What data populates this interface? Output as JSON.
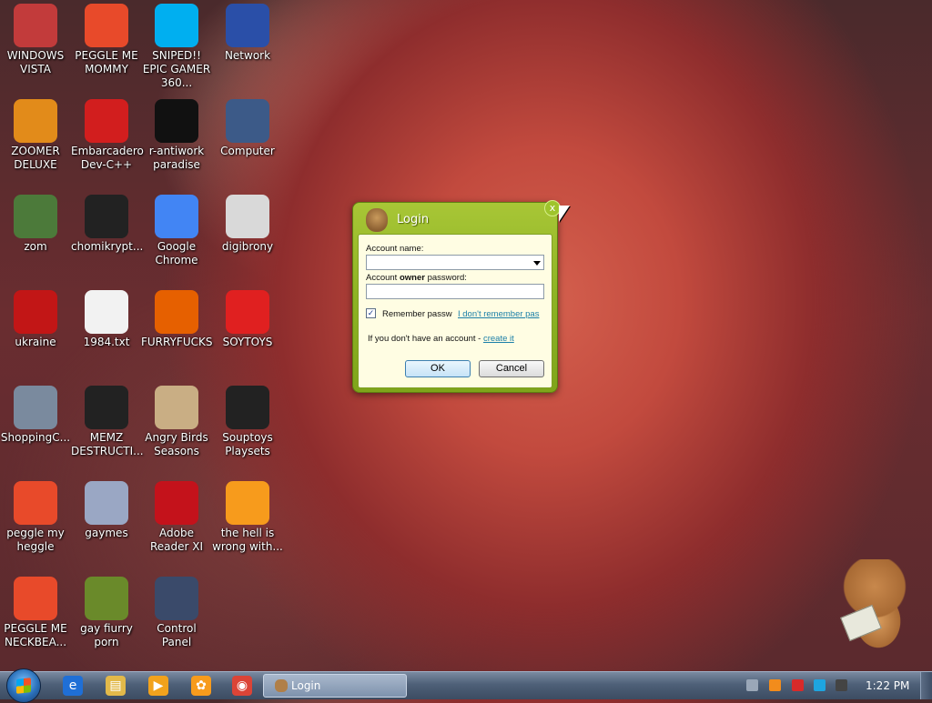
{
  "desktop": {
    "icons": [
      {
        "label": "WINDOWS VISTA",
        "icon": "windows-vista-icon",
        "color": "#c23b3b"
      },
      {
        "label": "PEGGLE ME MOMMY",
        "icon": "peggle-icon",
        "color": "#e84a2a"
      },
      {
        "label": "SNIPED!! EPIC GAMER 360...",
        "icon": "skype-icon",
        "color": "#00aff0"
      },
      {
        "label": "Network",
        "icon": "network-icon",
        "color": "#2a4fa8"
      },
      {
        "label": "ZOOMER DELUXE",
        "icon": "zoomer-icon",
        "color": "#e28b1a"
      },
      {
        "label": "Embarcadero Dev-C++",
        "icon": "dev-cpp-icon",
        "color": "#d21e1e"
      },
      {
        "label": "r-antiwork paradise",
        "icon": "antiwork-icon",
        "color": "#111111"
      },
      {
        "label": "Computer",
        "icon": "computer-icon",
        "color": "#3c5a88"
      },
      {
        "label": "zom",
        "icon": "zom-icon",
        "color": "#4c7a3a"
      },
      {
        "label": "chomikrypt...",
        "icon": "chomikrypt-icon",
        "color": "#222222"
      },
      {
        "label": "Google Chrome",
        "icon": "chrome-icon",
        "color": "#4285f4"
      },
      {
        "label": "digibrony",
        "icon": "digibrony-icon",
        "color": "#d9d9d9"
      },
      {
        "label": "ukraine",
        "icon": "radiation-icon",
        "color": "#c21616"
      },
      {
        "label": "1984.txt",
        "icon": "text-file-icon",
        "color": "#f2f2f2"
      },
      {
        "label": "FURRYFUCKS",
        "icon": "firefox-icon",
        "color": "#e66000"
      },
      {
        "label": "SOYTOYS",
        "icon": "soytoys-icon",
        "color": "#e02020"
      },
      {
        "label": "ShoppingC...",
        "icon": "flash-icon",
        "color": "#7a8a9e"
      },
      {
        "label": "MEMZ DESTRUCTI...",
        "icon": "memz-icon",
        "color": "#222222"
      },
      {
        "label": "Angry Birds Seasons",
        "icon": "angry-birds-icon",
        "color": "#c9ae84"
      },
      {
        "label": "Souptoys Playsets",
        "icon": "souptoys-icon",
        "color": "#222222"
      },
      {
        "label": "peggle my heggle",
        "icon": "peggle-icon",
        "color": "#e84a2a"
      },
      {
        "label": "gaymes",
        "icon": "games-folder-icon",
        "color": "#9aa7c4"
      },
      {
        "label": "Adobe Reader XI",
        "icon": "adobe-reader-icon",
        "color": "#c4121b"
      },
      {
        "label": "the hell is wrong with...",
        "icon": "uc-browser-icon",
        "color": "#f79b1c"
      },
      {
        "label": "PEGGLE ME NECKBEA...",
        "icon": "peggle-icon",
        "color": "#e84a2a"
      },
      {
        "label": "gay fiurry porn",
        "icon": "box-hamster-icon",
        "color": "#6a8a2a"
      },
      {
        "label": "Control Panel",
        "icon": "control-panel-icon",
        "color": "#3a4a6a"
      }
    ]
  },
  "dialog": {
    "title": "Login",
    "close_glyph": "x",
    "account_name_label": "Account name:",
    "password_label_pre": "Account ",
    "password_label_bold": "owner",
    "password_label_post": " password:",
    "account_name_value": "",
    "password_value": "",
    "remember_label": "Remember passw",
    "remember_checked": true,
    "remember_check_glyph": "✓",
    "forgot_link": "I don't remember pas",
    "no_account_text": "If you don't have an account - ",
    "create_link": "create it",
    "ok_label": "OK",
    "cancel_label": "Cancel",
    "accent_color": "#8db324"
  },
  "taskbar": {
    "pinned": [
      {
        "icon": "internet-explorer-icon",
        "glyph": "e",
        "color": "#1f6fd6"
      },
      {
        "icon": "explorer-folder-icon",
        "glyph": "▤",
        "color": "#e2b94a"
      },
      {
        "icon": "media-player-icon",
        "glyph": "▶",
        "color": "#f2a21c"
      },
      {
        "icon": "uc-browser-icon",
        "glyph": "✿",
        "color": "#f79b1c"
      },
      {
        "icon": "chrome-icon",
        "glyph": "◉",
        "color": "#db4437"
      }
    ],
    "active_window": "Login",
    "tray": [
      {
        "icon": "network-tray-icon",
        "color": "#9aa7b8"
      },
      {
        "icon": "search-tray-icon",
        "color": "#f28c1c"
      },
      {
        "icon": "flag-tray-icon",
        "color": "#d82a2a"
      },
      {
        "icon": "display-tray-icon",
        "color": "#1ea5e0"
      },
      {
        "icon": "volume-tray-icon",
        "color": "#444444"
      }
    ],
    "clock": "1:22 PM"
  }
}
